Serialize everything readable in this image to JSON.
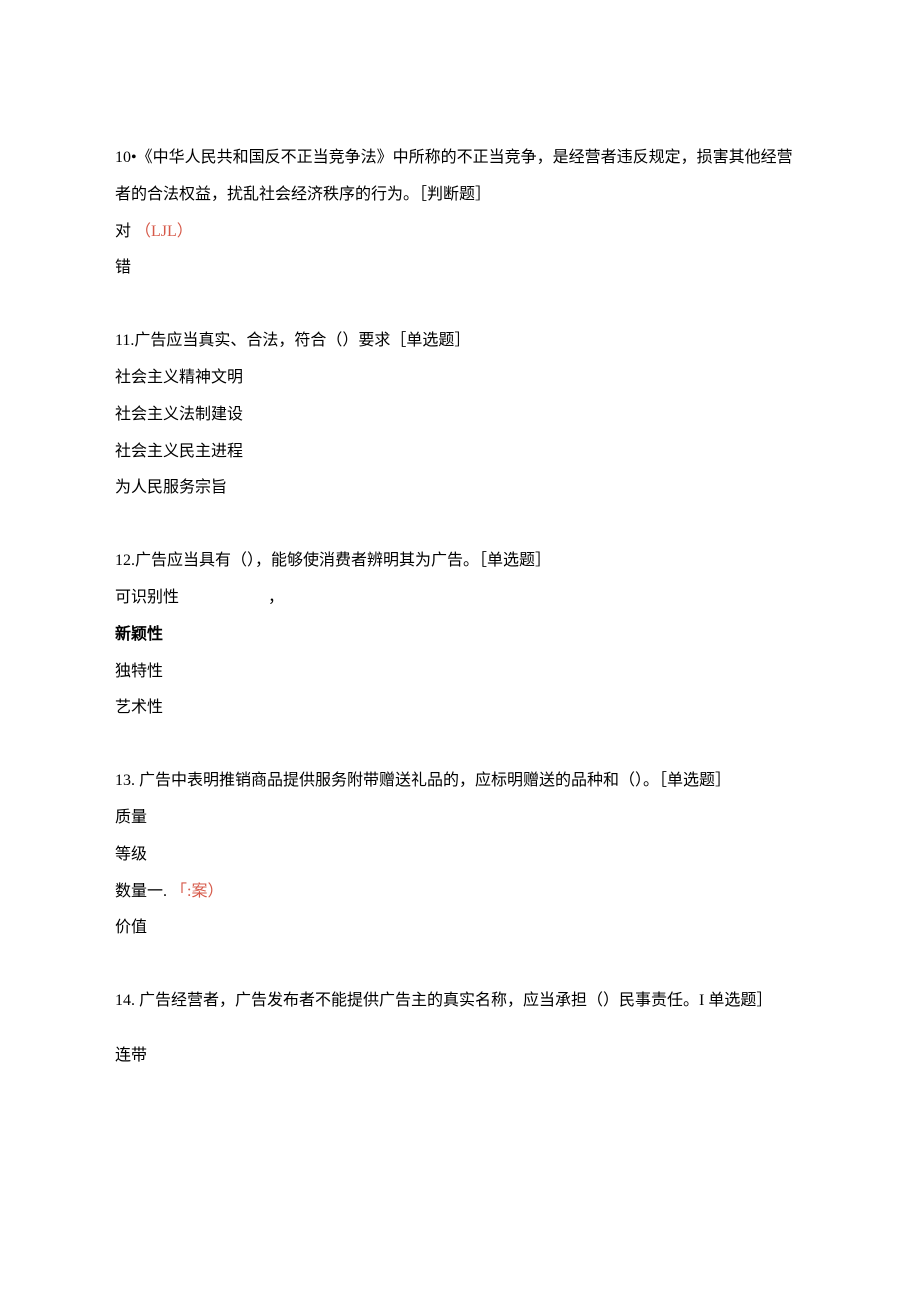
{
  "q10": {
    "text": "10•《中华人民共和国反不正当竞争法》中所称的不正当竞争，是经营者违反规定，损害其他经营者的合法权益，扰乱社会经济秩序的行为。［判断题］",
    "opt1_prefix": "对",
    "opt1_answer": "（LJL）",
    "opt2": "错"
  },
  "q11": {
    "text": "11.广告应当真实、合法，符合（）要求［单选题］",
    "opt1": "社会主义精神文明",
    "opt2": "社会主义法制建设",
    "opt3": "社会主义民主进程",
    "opt4": "为人民服务宗旨"
  },
  "q12": {
    "text": "12.广告应当具有（），能够使消费者辨明其为广告。［单选题］",
    "opt1": "可识别性",
    "opt1_comma": "，",
    "opt2": "新颖性",
    "opt3": "独特性",
    "opt4": "艺术性"
  },
  "q13": {
    "text": "13. 广告中表明推销商品提供服务附带赠送礼品的，应标明赠送的品种和（）。［单选题］",
    "opt1": "质量",
    "opt2": "等级",
    "opt3_prefix": "数量一.",
    "opt3_answer": "「:案）",
    "opt4": "价值"
  },
  "q14": {
    "text": "14. 广告经营者，广告发布者不能提供广告主的真实名称，应当承担（）民事责任。I 单选题］",
    "opt1": "连带"
  }
}
